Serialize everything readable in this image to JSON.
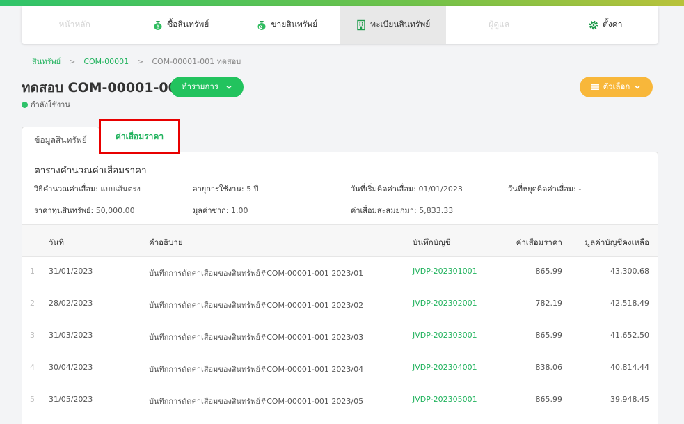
{
  "colors": {
    "brand_green": "#22c35e",
    "accent_orange": "#f8b73a",
    "highlight_red": "#e80000"
  },
  "nav": [
    {
      "label": "หน้าหลัก",
      "icon": "",
      "state": "disabled"
    },
    {
      "label": "ซื้อสินทรัพย์",
      "icon": "money-bag-icon",
      "state": "normal"
    },
    {
      "label": "ขายสินทรัพย์",
      "icon": "money-bag-clock-icon",
      "state": "normal"
    },
    {
      "label": "ทะเบียนสินทรัพย์",
      "icon": "building-icon",
      "state": "active"
    },
    {
      "label": "ผู้ดูแล",
      "icon": "",
      "state": "disabled"
    },
    {
      "label": "ตั้งค่า",
      "icon": "gear-icon",
      "state": "normal"
    }
  ],
  "breadcrumb": {
    "item1": "สินทรัพย์",
    "item2": "COM-00001",
    "item3": "COM-00001-001 ทดสอบ",
    "sep": ">"
  },
  "header": {
    "title": "ทดสอบ COM-00001-001",
    "status": "กำลังใช้งาน",
    "action_label": "ทำรายการ",
    "options_label": "ตัวเลือก"
  },
  "tabs": {
    "info": "ข้อมูลสินทรัพย์",
    "depreciation": "ค่าเสื่อมราคา"
  },
  "panel": {
    "title": "ตารางคำนวณค่าเสื่อมราคา",
    "method_label": "วิธีคำนวณค่าเสื่อม:",
    "method_value": "แบบเส้นตรง",
    "life_label": "อายุการใช้งาน:",
    "life_value": "5 ปี",
    "start_label": "วันที่เริ่มคิดค่าเสื่อม:",
    "start_value": "01/01/2023",
    "stop_label": "วันที่หยุดคิดค่าเสื่อม:",
    "stop_value": "-",
    "cost_label": "ราคาทุนสินทรัพย์:",
    "cost_value": "50,000.00",
    "salvage_label": "มูลค่าซาก:",
    "salvage_value": "1.00",
    "accum_label": "ค่าเสื่อมสะสมยกมา:",
    "accum_value": "5,833.33"
  },
  "table": {
    "headers": {
      "date": "วันที่",
      "desc": "คำอธิบาย",
      "journal": "บันทึกบัญชี",
      "depreciation": "ค่าเสื่อมราคา",
      "book_value": "มูลค่าบัญชีคงเหลือ"
    },
    "rows": [
      {
        "idx": "1",
        "date": "31/01/2023",
        "desc": "บันทึกการตัดค่าเสื่อมของสินทรัพย์#COM-00001-001 2023/01",
        "journal": "JVDP-202301001",
        "dep": "865.99",
        "book": "43,300.68"
      },
      {
        "idx": "2",
        "date": "28/02/2023",
        "desc": "บันทึกการตัดค่าเสื่อมของสินทรัพย์#COM-00001-001 2023/02",
        "journal": "JVDP-202302001",
        "dep": "782.19",
        "book": "42,518.49"
      },
      {
        "idx": "3",
        "date": "31/03/2023",
        "desc": "บันทึกการตัดค่าเสื่อมของสินทรัพย์#COM-00001-001 2023/03",
        "journal": "JVDP-202303001",
        "dep": "865.99",
        "book": "41,652.50"
      },
      {
        "idx": "4",
        "date": "30/04/2023",
        "desc": "บันทึกการตัดค่าเสื่อมของสินทรัพย์#COM-00001-001 2023/04",
        "journal": "JVDP-202304001",
        "dep": "838.06",
        "book": "40,814.44"
      },
      {
        "idx": "5",
        "date": "31/05/2023",
        "desc": "บันทึกการตัดค่าเสื่อมของสินทรัพย์#COM-00001-001 2023/05",
        "journal": "JVDP-202305001",
        "dep": "865.99",
        "book": "39,948.45"
      }
    ]
  }
}
